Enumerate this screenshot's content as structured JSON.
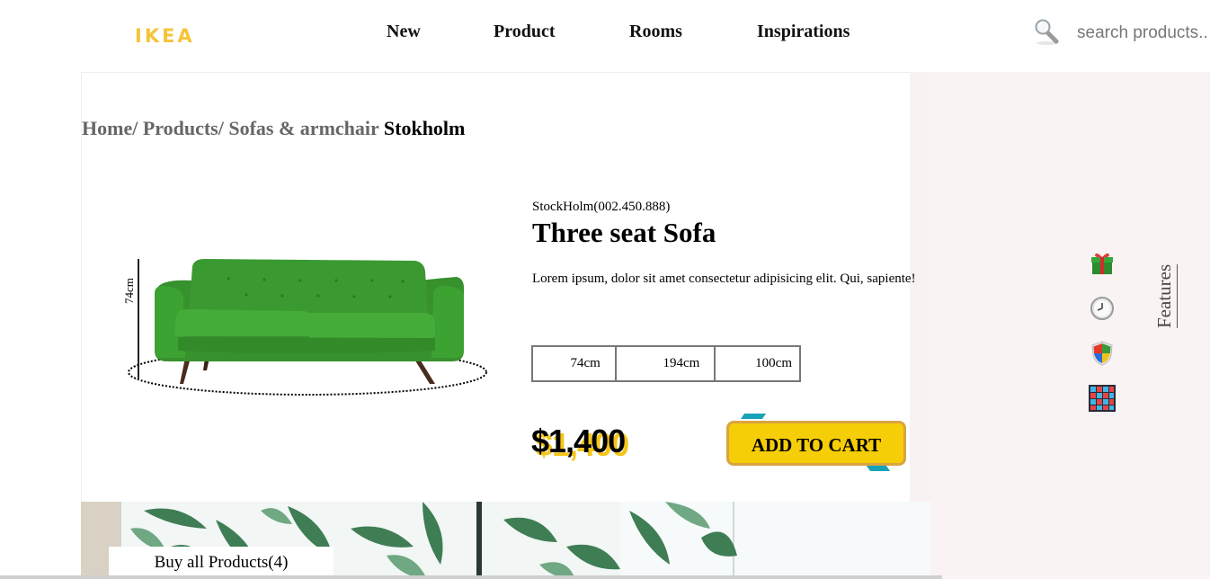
{
  "header": {
    "logo": "IKEA",
    "nav": [
      "New",
      "Product",
      "Rooms",
      "Inspirations"
    ],
    "search_placeholder": "search products.."
  },
  "breadcrumb": {
    "path": "Home/ Products/ Sofas & armchair",
    "current": "Stokholm"
  },
  "product": {
    "sku": "StockHolm(002.450.888)",
    "title": "Three seat Sofa",
    "description": "Lorem ipsum, dolor sit amet consectetur adipisicing elit. Qui, sapiente!",
    "height_label": "74cm",
    "dimensions": [
      "74cm",
      "194cm",
      "100cm"
    ],
    "price": "$1,400",
    "add_to_cart": "ADD TO CART",
    "color": "#3e9a33"
  },
  "features": {
    "label": "Features",
    "icons": [
      "gift-icon",
      "clock-icon",
      "shield-icon",
      "grid-icon"
    ]
  },
  "banner": {
    "buy_all": "Buy all Products(4)"
  },
  "colors": {
    "logo": "#f6c43a",
    "cart_button": "#f6ce08",
    "accent": "#17a2b8",
    "sidebar": "#f9f3f3"
  }
}
